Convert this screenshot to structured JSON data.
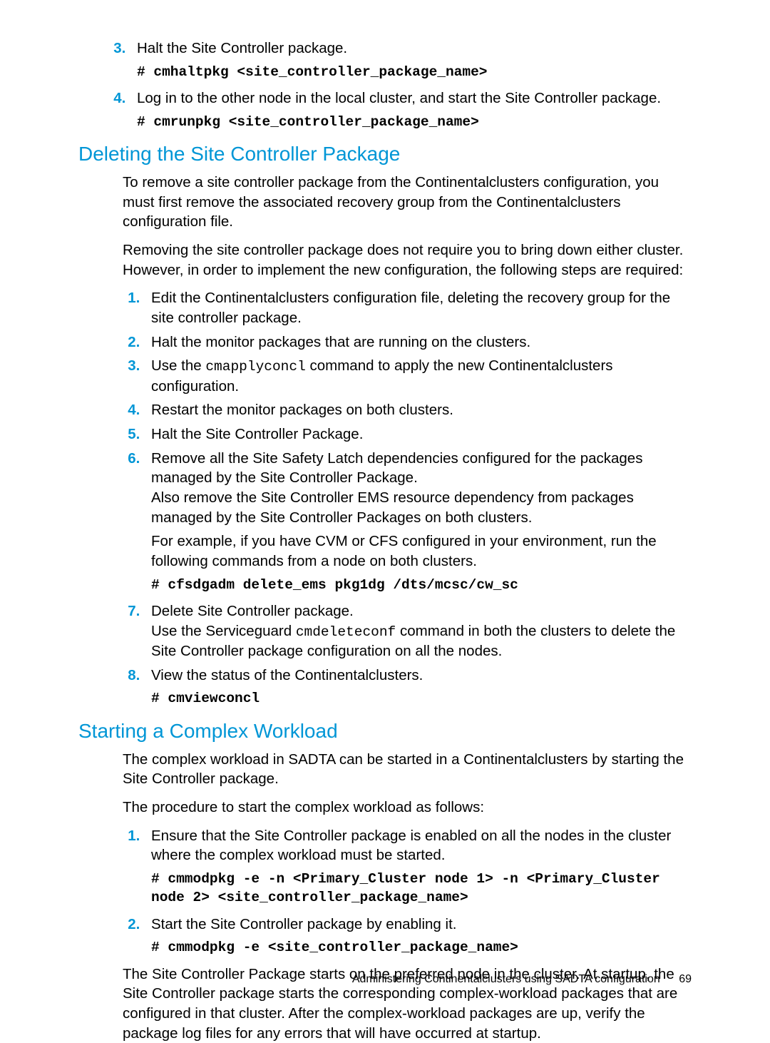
{
  "intro_list": {
    "items": [
      {
        "num": "3.",
        "text": "Halt the Site Controller package.",
        "cmd": "# cmhaltpkg <site_controller_package_name>"
      },
      {
        "num": "4.",
        "text": "Log in to the other node in the local cluster, and start the Site Controller package.",
        "cmd": "# cmrunpkg <site_controller_package_name>"
      }
    ]
  },
  "section1": {
    "heading": "Deleting the Site Controller Package",
    "para1": "To remove a site controller package from the Continentalclusters configuration, you must first remove the associated recovery group from the Continentalclusters configuration file.",
    "para2": "Removing the site controller package does not require you to bring down either cluster. However, in order to implement the new configuration, the following steps are required:",
    "list": {
      "i1": "Edit the Continentalclusters configuration file, deleting the recovery group for the site controller package.",
      "i2": "Halt the monitor packages that are running on the clusters.",
      "i3a": "Use the ",
      "i3code": "cmapplyconcl",
      "i3b": " command to apply the new Continentalclusters configuration.",
      "i4": "Restart the monitor packages on both clusters.",
      "i5": "Halt the Site Controller Package.",
      "i6a": "Remove all the Site Safety Latch dependencies configured for the packages managed by the Site Controller Package.",
      "i6b": "Also remove the Site Controller EMS resource dependency from packages managed by the Site Controller Packages on both clusters.",
      "i6c": "For example, if you have CVM or CFS configured in your environment, run the following commands from a node on both clusters.",
      "i6cmd": "# cfsdgadm delete_ems pkg1dg /dts/mcsc/cw_sc",
      "i7a": "Delete Site Controller package.",
      "i7b_pre": "Use the Serviceguard ",
      "i7b_code": "cmdeleteconf",
      "i7b_post": " command in both the clusters to delete the Site Controller package configuration on all the nodes.",
      "i8a": "View the status of the Continentalclusters.",
      "i8cmd": "# cmviewconcl"
    }
  },
  "section2": {
    "heading": "Starting a Complex Workload",
    "para1": "The complex workload in SADTA can be started in a Continentalclusters by starting the Site Controller package.",
    "para2": "The procedure to start the complex workload as follows:",
    "list": {
      "i1a": "Ensure that the Site Controller package is enabled on all the nodes in the cluster where the complex workload must be started.",
      "i1cmd": "# cmmodpkg -e -n <Primary_Cluster node 1> -n <Primary_Cluster node 2> <site_controller_package_name>",
      "i2a": "Start the Site Controller package by enabling it.",
      "i2cmd": "# cmmodpkg -e <site_controller_package_name>"
    },
    "para3": "The Site Controller Package starts on the preferred node in the cluster. At startup, the Site Controller package starts the corresponding complex-workload packages that are configured in that cluster. After the complex-workload packages are up, verify the package log files for any errors that will have occurred at startup."
  },
  "footer": {
    "text": "Administering Continentalclusters using SADTA configuration",
    "page": "69"
  }
}
